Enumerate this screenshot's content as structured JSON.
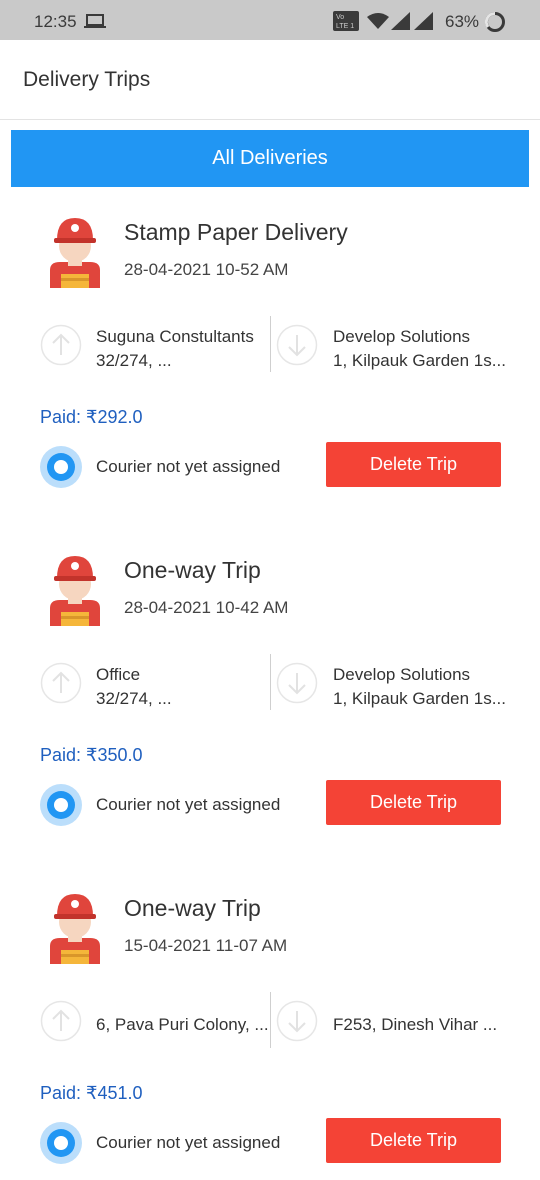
{
  "status_bar": {
    "time": "12:35",
    "lte_label_top": "Vo",
    "lte_label_bottom": "LTE 1",
    "battery_percent": "63%"
  },
  "app_bar": {
    "title": "Delivery Trips"
  },
  "tab": {
    "label": "All Deliveries"
  },
  "colors": {
    "tab_blue": "#2196f3",
    "delete_red": "#f44336",
    "paid_blue": "#1f5fbf"
  },
  "trips": [
    {
      "title": "Stamp Paper Delivery",
      "datetime": "28-04-2021 10-52 AM",
      "from_name": "Suguna Constultants",
      "from_address": "32/274, ...",
      "to_name": "Develop Solutions",
      "to_address": "1, Kilpauk Garden 1s...",
      "paid": "Paid: ₹292.0",
      "status": "Courier not yet assigned",
      "delete_label": "Delete Trip"
    },
    {
      "title": "One-way Trip",
      "datetime": "28-04-2021 10-42 AM",
      "from_name": "Office",
      "from_address": "32/274, ...",
      "to_name": "Develop Solutions",
      "to_address": "1, Kilpauk Garden 1s...",
      "paid": "Paid: ₹350.0",
      "status": "Courier not yet assigned",
      "delete_label": "Delete Trip"
    },
    {
      "title": "One-way Trip",
      "datetime": "15-04-2021 11-07 AM",
      "from_address": "6, Pava Puri Colony, ...",
      "to_address": "F253, Dinesh Vihar ...",
      "paid": "Paid: ₹451.0",
      "status": "Courier not yet assigned",
      "delete_label": "Delete Trip"
    }
  ]
}
